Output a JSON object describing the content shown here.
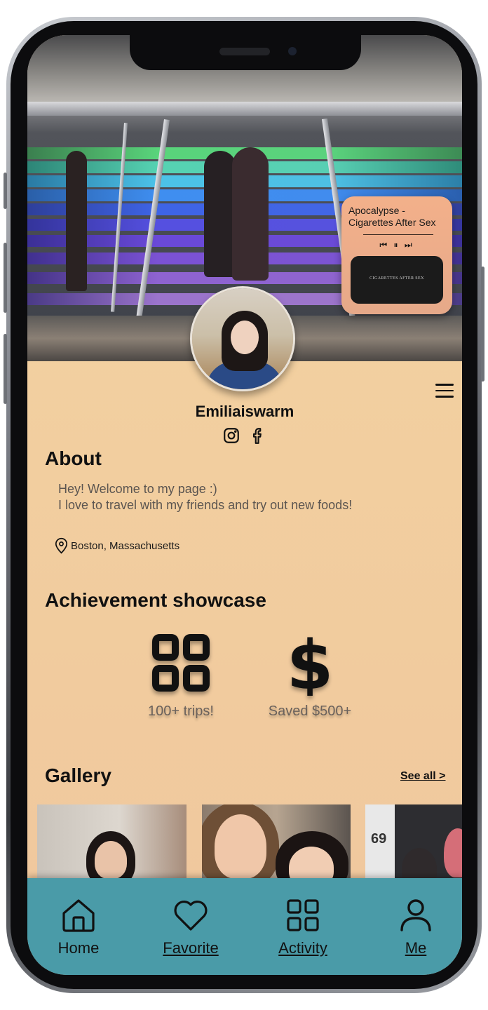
{
  "music": {
    "title": "Apocalypse - Cigarettes After Sex",
    "controls": {
      "prev": "⏮",
      "pause": "⏸",
      "next": "⏭"
    },
    "album_text": "CIGARETTES AFTER SEX"
  },
  "profile": {
    "username": "Emiliaiswarm",
    "socials": [
      "instagram-icon",
      "facebook-icon"
    ]
  },
  "about": {
    "title": "About",
    "line1": "Hey! Welcome to my page :)",
    "line2": "I love to travel with my friends and try out new foods!",
    "location": "Boston, Massachusetts"
  },
  "achievements": {
    "title": "Achievement showcase",
    "items": [
      {
        "icon": "grid-icon",
        "label": "100+ trips!"
      },
      {
        "icon": "dollar-icon",
        "label": "Saved $500+"
      }
    ]
  },
  "gallery": {
    "title": "Gallery",
    "see_all": "See all >",
    "photo3_tag": "69"
  },
  "nav": {
    "items": [
      {
        "label": "Home",
        "icon": "home-icon"
      },
      {
        "label": "Favorite",
        "icon": "heart-icon"
      },
      {
        "label": "Activity",
        "icon": "grid-icon"
      },
      {
        "label": "Me",
        "icon": "user-icon"
      }
    ]
  },
  "colors": {
    "background_top": "#f3d4a1",
    "background_bottom": "#f0c79d",
    "nav_bar": "#4a9ba8",
    "music_widget": "#f3b08a"
  }
}
